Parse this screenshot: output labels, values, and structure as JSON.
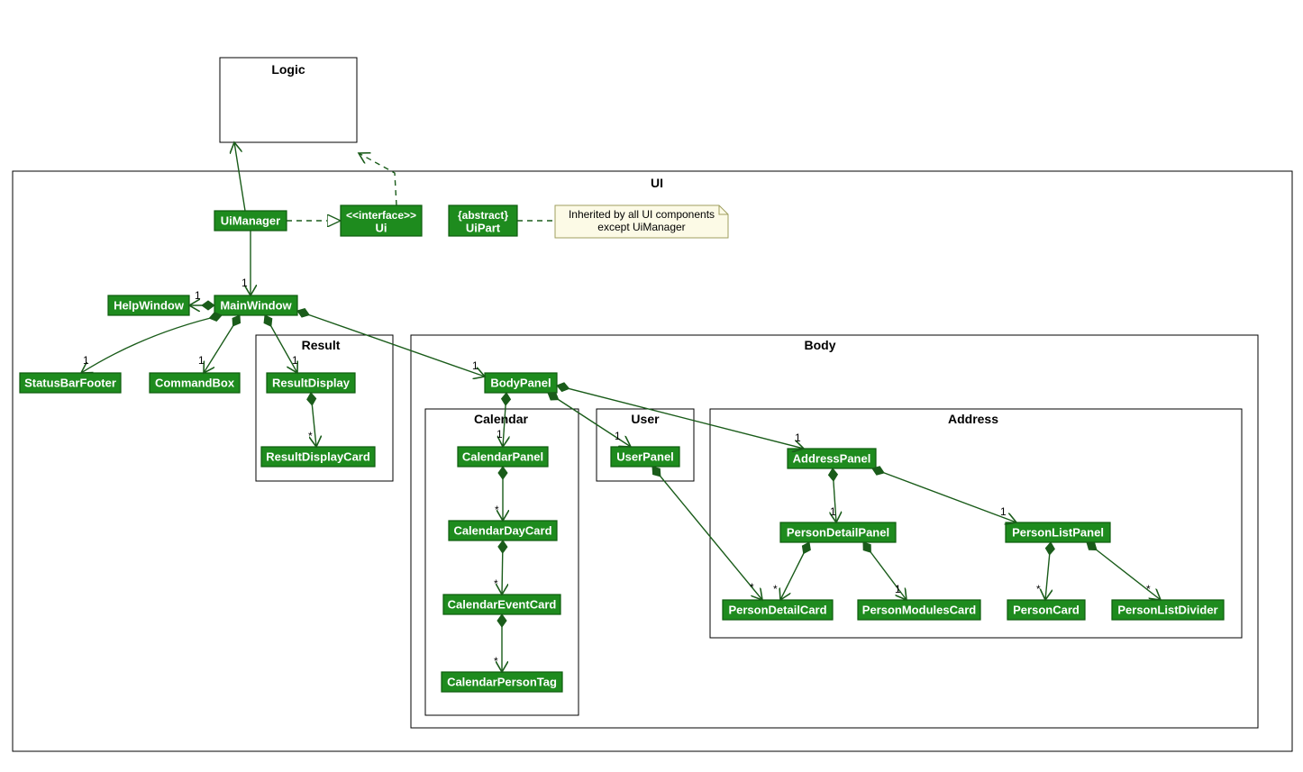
{
  "packages": {
    "logic": {
      "title": "Logic"
    },
    "ui": {
      "title": "UI"
    },
    "result": {
      "title": "Result"
    },
    "body": {
      "title": "Body"
    },
    "calendar": {
      "title": "Calendar"
    },
    "user": {
      "title": "User"
    },
    "address": {
      "title": "Address"
    }
  },
  "nodes": {
    "UiManager": "UiManager",
    "UiInterface_top": "<<interface>>",
    "UiInterface_name": "Ui",
    "UiPart_top": "{abstract}",
    "UiPart_name": "UiPart",
    "HelpWindow": "HelpWindow",
    "MainWindow": "MainWindow",
    "StatusBarFooter": "StatusBarFooter",
    "CommandBox": "CommandBox",
    "ResultDisplay": "ResultDisplay",
    "ResultDisplayCard": "ResultDisplayCard",
    "BodyPanel": "BodyPanel",
    "CalendarPanel": "CalendarPanel",
    "CalendarDayCard": "CalendarDayCard",
    "CalendarEventCard": "CalendarEventCard",
    "CalendarPersonTag": "CalendarPersonTag",
    "UserPanel": "UserPanel",
    "AddressPanel": "AddressPanel",
    "PersonDetailPanel": "PersonDetailPanel",
    "PersonListPanel": "PersonListPanel",
    "PersonDetailCard": "PersonDetailCard",
    "PersonModulesCard": "PersonModulesCard",
    "PersonCard": "PersonCard",
    "PersonListDivider": "PersonListDivider"
  },
  "note": {
    "line1": "Inherited by all UI components",
    "line2": "except UiManager"
  },
  "multiplicities": {
    "one": "1",
    "star": "*"
  }
}
